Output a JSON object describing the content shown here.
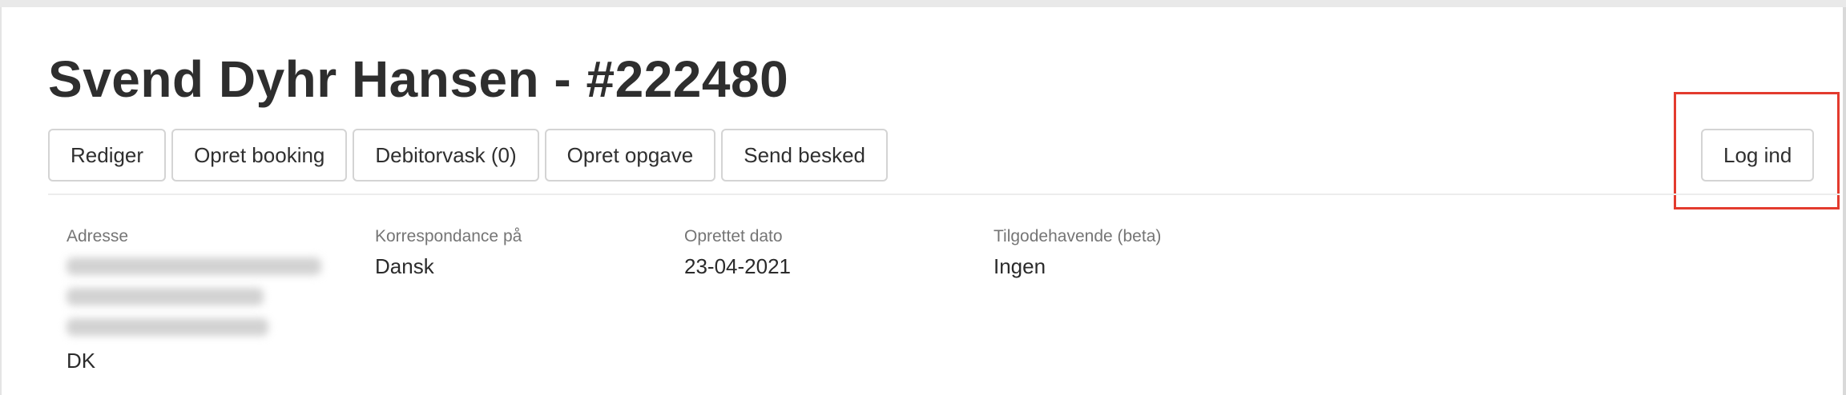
{
  "customer": {
    "title": "Svend Dyhr Hansen - #222480"
  },
  "toolbar": {
    "buttons": [
      {
        "label": "Rediger"
      },
      {
        "label": "Opret booking"
      },
      {
        "label": "Debitorvask (0)"
      },
      {
        "label": "Opret opgave"
      },
      {
        "label": "Send besked"
      }
    ],
    "login_label": "Log ind"
  },
  "info": {
    "address": {
      "label": "Adresse",
      "country": "DK"
    },
    "correspondence": {
      "label": "Korrespondance på",
      "value": "Dansk"
    },
    "created": {
      "label": "Oprettet dato",
      "value": "23-04-2021"
    },
    "receivable": {
      "label": "Tilgodehavende (beta)",
      "value": "Ingen"
    }
  },
  "colors": {
    "highlight": "#e33b2e",
    "button_border": "#d4d4d4",
    "label_gray": "#757575"
  }
}
